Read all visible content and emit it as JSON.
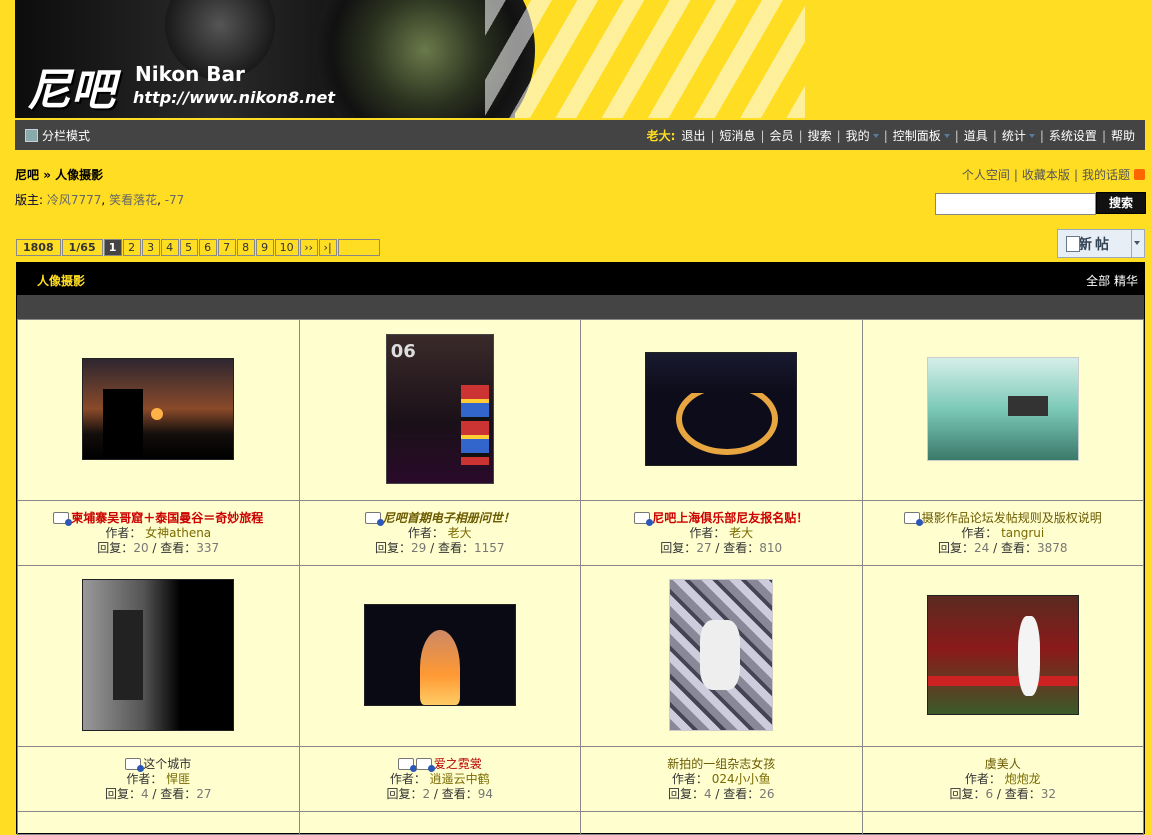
{
  "banner": {
    "logo_cn": "尼吧",
    "logo_en": "Nikon Bar",
    "logo_url": "http://www.nikon8.net"
  },
  "nav": {
    "mode_label": "分栏模式",
    "user": "老大:",
    "items": [
      "退出",
      "短消息",
      "会员",
      "搜索",
      "我的",
      "控制面板",
      "道具",
      "统计",
      "系统设置",
      "帮助"
    ]
  },
  "crumb": {
    "home": "尼吧",
    "sep": "»",
    "forum": "人像摄影"
  },
  "moderators": {
    "label": "版主:",
    "names": [
      "冷风7777",
      "笑看落花",
      "-77"
    ]
  },
  "toplinks": [
    "个人空间",
    "收藏本版",
    "我的话题"
  ],
  "search": {
    "button": "搜索",
    "value": ""
  },
  "pager": {
    "total": "1808",
    "pages": "1/65",
    "current": "1",
    "numbers": [
      "2",
      "3",
      "4",
      "5",
      "6",
      "7",
      "8",
      "9",
      "10"
    ],
    "next": "››",
    "last": "›|"
  },
  "newpost": {
    "label": "新帖"
  },
  "forum_box": {
    "title": "人像摄影",
    "links": "全部  精华"
  },
  "labels": {
    "author": "作者：",
    "reply": "回复：",
    "view": "查看："
  },
  "threads": [
    {
      "title": "柬埔寨吴哥窟＋泰国曼谷＝奇妙旅程",
      "style": "red",
      "author": "女神athena",
      "replies": "20",
      "views": "337",
      "img": "sunset"
    },
    {
      "title": "尼吧首期电子相册问世！",
      "style": "olive",
      "author": "老大",
      "replies": "29",
      "views": "1157",
      "img": "poster"
    },
    {
      "title": "尼吧上海俱乐部尼友报名贴！",
      "style": "red",
      "author": "老大",
      "replies": "27",
      "views": "810",
      "img": "night"
    },
    {
      "title": "摄影作品论坛发帖规则及版权说明",
      "style": "olive-plain",
      "author": "tangrui",
      "replies": "24",
      "views": "3878",
      "img": "boat"
    },
    {
      "title": "这个城市",
      "style": "plain",
      "author": "悍匪",
      "replies": "4",
      "views": "27",
      "img": "city"
    },
    {
      "title": "爱之霓裳",
      "style": "red-plain",
      "author": "逍遥云中鹤",
      "replies": "2",
      "views": "94",
      "img": "dress"
    },
    {
      "title": "新拍的一组杂志女孩",
      "style": "olive-plain",
      "author": "024小小鱼",
      "replies": "4",
      "views": "26",
      "img": "magazine"
    },
    {
      "title": "虞美人",
      "style": "olive-plain",
      "author": "炮炮龙",
      "replies": "6",
      "views": "32",
      "img": "beauty"
    }
  ]
}
